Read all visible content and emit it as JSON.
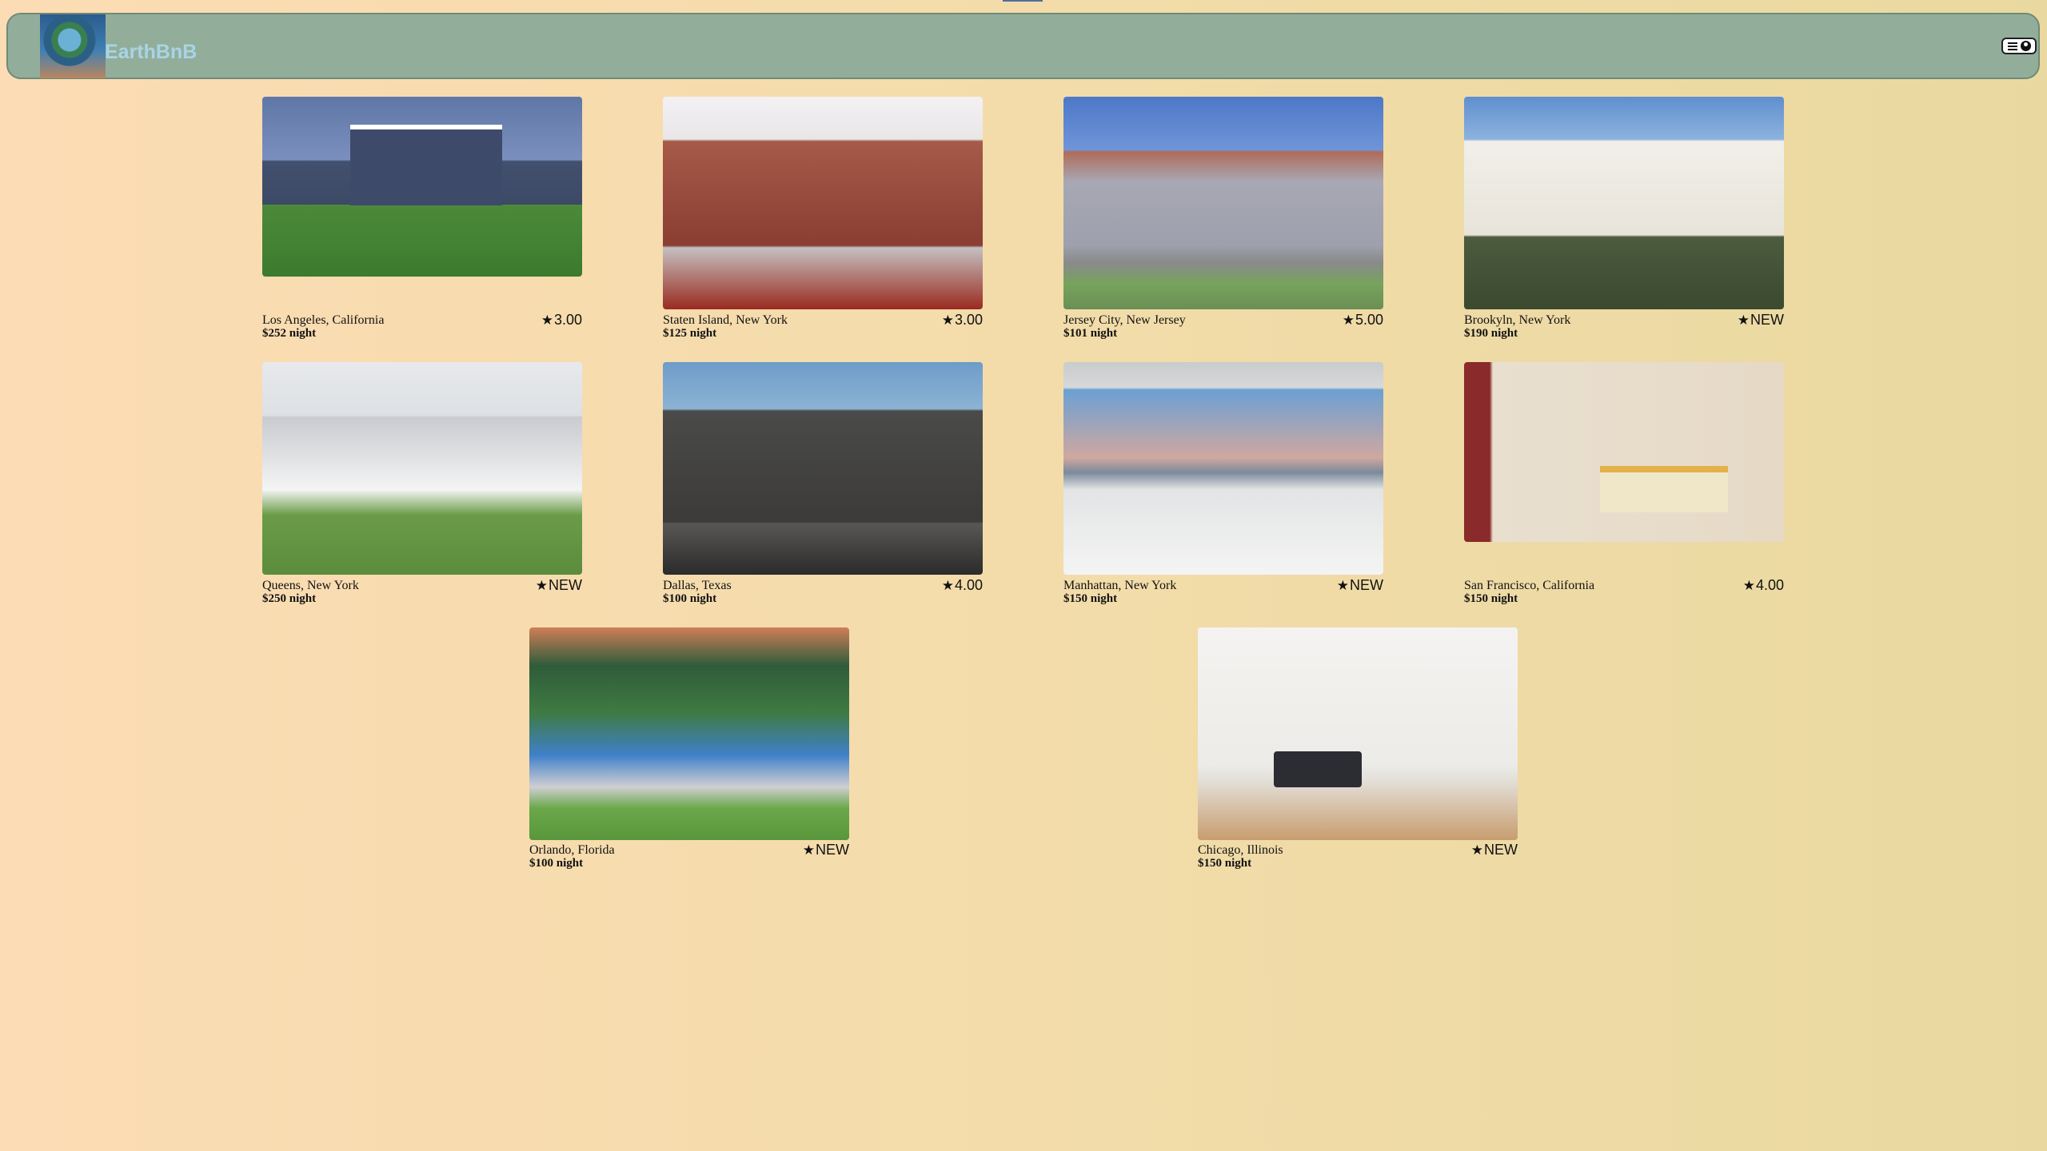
{
  "app": {
    "name": "EarthBnB",
    "logo_icon": "globe-in-hands-icon",
    "menu_icons": [
      "hamburger-icon",
      "user-icon"
    ]
  },
  "listings": [
    {
      "location": "Los Angeles, California",
      "price": "$252 night",
      "rating": "3.00"
    },
    {
      "location": "Staten Island, New York",
      "price": "$125 night",
      "rating": "3.00"
    },
    {
      "location": "Jersey City, New Jersey",
      "price": "$101 night",
      "rating": "5.00"
    },
    {
      "location": "Brookyln, New York",
      "price": "$190 night",
      "rating": "NEW"
    },
    {
      "location": "Queens, New York",
      "price": "$250 night",
      "rating": "NEW"
    },
    {
      "location": "Dallas, Texas",
      "price": "$100 night",
      "rating": "4.00"
    },
    {
      "location": "Manhattan, New York",
      "price": "$150 night",
      "rating": "NEW"
    },
    {
      "location": "San Francisco, California",
      "price": "$150 night",
      "rating": "4.00"
    },
    {
      "location": "Orlando, Florida",
      "price": "$100 night",
      "rating": "NEW"
    },
    {
      "location": "Chicago, Illinois",
      "price": "$150 night",
      "rating": "NEW"
    }
  ],
  "star_glyph": "★"
}
